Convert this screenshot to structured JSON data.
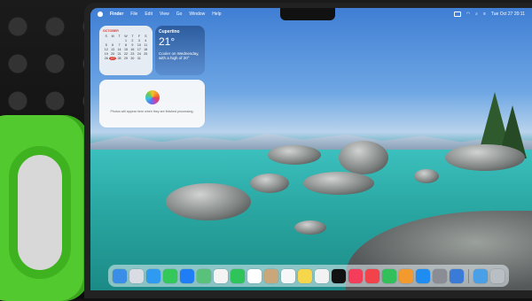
{
  "menubar": {
    "items": [
      "Finder",
      "File",
      "Edit",
      "View",
      "Go",
      "Window",
      "Help"
    ],
    "clock": "Tue Oct 27 20:11"
  },
  "calendar": {
    "month": "OCTOBER",
    "weekdays": [
      "S",
      "M",
      "T",
      "W",
      "T",
      "F",
      "S"
    ],
    "days": [
      "",
      "",
      "",
      "1",
      "2",
      "3",
      "4",
      "5",
      "6",
      "7",
      "8",
      "9",
      "10",
      "11",
      "12",
      "13",
      "14",
      "15",
      "16",
      "17",
      "18",
      "19",
      "20",
      "21",
      "22",
      "23",
      "24",
      "25",
      "26",
      "27",
      "28",
      "29",
      "30",
      "31"
    ],
    "today": "27"
  },
  "weather": {
    "city": "Cupertino",
    "temp": "21°",
    "forecast": "Cooler on Wednesday, with a high of 20°"
  },
  "photos_widget": {
    "message": "Photos will appear here when they are finished processing."
  },
  "dock": {
    "apps": [
      {
        "name": "finder",
        "color": "#3a8ee6"
      },
      {
        "name": "launchpad",
        "color": "#d9dde3"
      },
      {
        "name": "safari",
        "color": "#2f9bf0"
      },
      {
        "name": "messages",
        "color": "#34c759"
      },
      {
        "name": "mail",
        "color": "#1f7ef5"
      },
      {
        "name": "maps",
        "color": "#5ac17a"
      },
      {
        "name": "photos",
        "color": "#f4f4f4"
      },
      {
        "name": "facetime",
        "color": "#2ec45a"
      },
      {
        "name": "calendar",
        "color": "#ffffff"
      },
      {
        "name": "contacts",
        "color": "#c9a77a"
      },
      {
        "name": "reminders",
        "color": "#f7f7f7"
      },
      {
        "name": "notes",
        "color": "#f6d64b"
      },
      {
        "name": "freeform",
        "color": "#f2f2f2"
      },
      {
        "name": "tv",
        "color": "#111111"
      },
      {
        "name": "music",
        "color": "#f43c5b"
      },
      {
        "name": "news",
        "color": "#f2434b"
      },
      {
        "name": "numbers",
        "color": "#31c05a"
      },
      {
        "name": "pages",
        "color": "#f39a2e"
      },
      {
        "name": "app-store",
        "color": "#1e8cf0"
      },
      {
        "name": "system-settings",
        "color": "#8a8e94"
      },
      {
        "name": "quicktime",
        "color": "#3b7bd8"
      },
      {
        "name": "downloads",
        "color": "#4aa0e6"
      },
      {
        "name": "trash",
        "color": "#b9bec4"
      }
    ]
  }
}
